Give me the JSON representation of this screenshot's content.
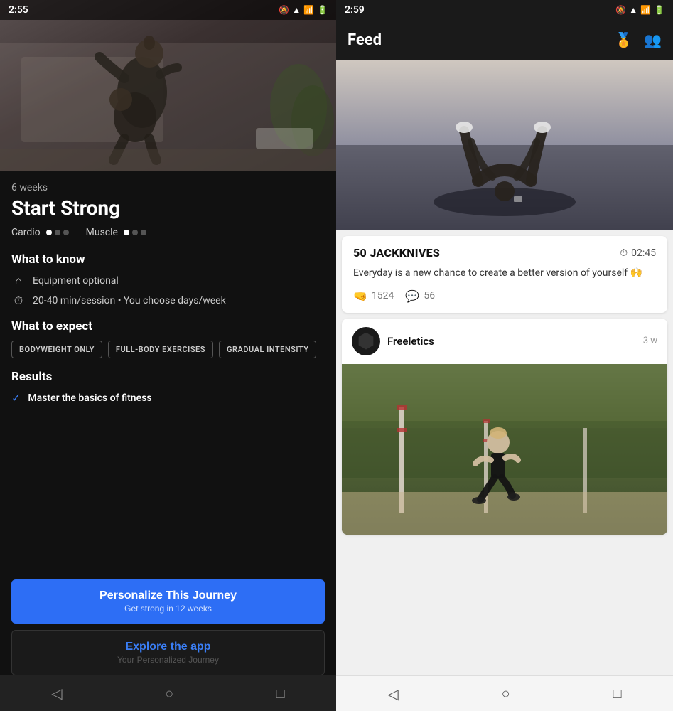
{
  "left": {
    "status_time": "2:55",
    "hero_alt": "Fitness training - Start Strong program",
    "weeks_label": "6 weeks",
    "program_title": "Start Strong",
    "difficulty": {
      "cardio_label": "Cardio",
      "cardio_dots": [
        true,
        false,
        false
      ],
      "muscle_label": "Muscle",
      "muscle_dots": [
        true,
        false,
        false
      ]
    },
    "what_to_know_title": "What to know",
    "equipment_text": "Equipment optional",
    "session_text": "20-40 min/session • You choose days/week",
    "what_to_expect_title": "What to expect",
    "tags": [
      "BODYWEIGHT ONLY",
      "FULL-BODY EXERCISES",
      "GRADUAL INTENSITY"
    ],
    "results_title": "Results",
    "result_item": "Master the basics of fitness",
    "btn_primary_text": "Personalize This Journey",
    "btn_primary_sub": "Get strong in 12 weeks",
    "btn_secondary_text": "Explore the app",
    "btn_secondary_sub": "Your Personalized Journey"
  },
  "right": {
    "status_time": "2:59",
    "feed_title": "Feed",
    "workout_card": {
      "name": "50 JACKKNIVES",
      "time": "02:45",
      "quote": "Everyday is a new chance to create a better version of yourself 🙌",
      "likes": "1524",
      "comments": "56"
    },
    "post": {
      "author_name": "Freeletics",
      "post_time": "3 w",
      "image_alt": "Runner on track"
    }
  }
}
